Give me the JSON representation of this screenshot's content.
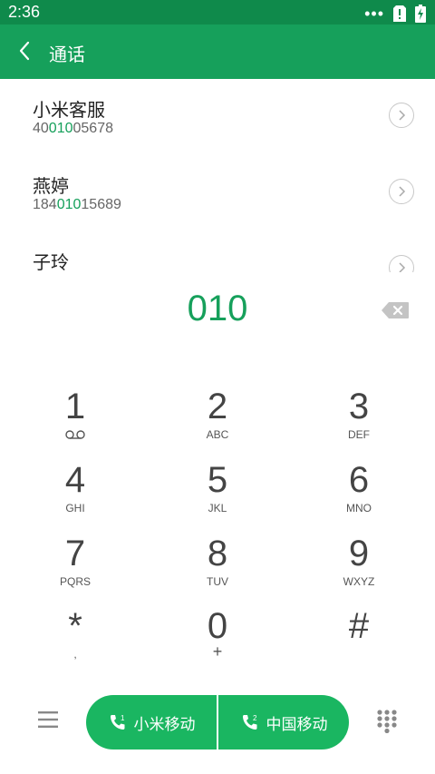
{
  "status_bar": {
    "time": "2:36"
  },
  "app_bar": {
    "title": "通话"
  },
  "contacts": [
    {
      "name": "小米客服",
      "number_pre": "40",
      "number_match": "010",
      "number_post": "05678"
    },
    {
      "name": "燕婷",
      "number_pre": "184",
      "number_match": "010",
      "number_post": "15689"
    },
    {
      "name": "子玲",
      "number_pre": "",
      "number_match": "",
      "number_post": ""
    }
  ],
  "dialer": {
    "input": "010"
  },
  "keypad": [
    {
      "digit": "1",
      "letters": ""
    },
    {
      "digit": "2",
      "letters": "ABC"
    },
    {
      "digit": "3",
      "letters": "DEF"
    },
    {
      "digit": "4",
      "letters": "GHI"
    },
    {
      "digit": "5",
      "letters": "JKL"
    },
    {
      "digit": "6",
      "letters": "MNO"
    },
    {
      "digit": "7",
      "letters": "PQRS"
    },
    {
      "digit": "8",
      "letters": "TUV"
    },
    {
      "digit": "9",
      "letters": "WXYZ"
    },
    {
      "digit": "*",
      "letters": ","
    },
    {
      "digit": "0",
      "letters": "+"
    },
    {
      "digit": "#",
      "letters": ""
    }
  ],
  "call_buttons": {
    "sim1_label": "小米移动",
    "sim2_label": "中国移动"
  },
  "colors": {
    "header": "#16a05b",
    "status": "#0f8a4b",
    "accent": "#16a05b",
    "call": "#1ab661"
  }
}
